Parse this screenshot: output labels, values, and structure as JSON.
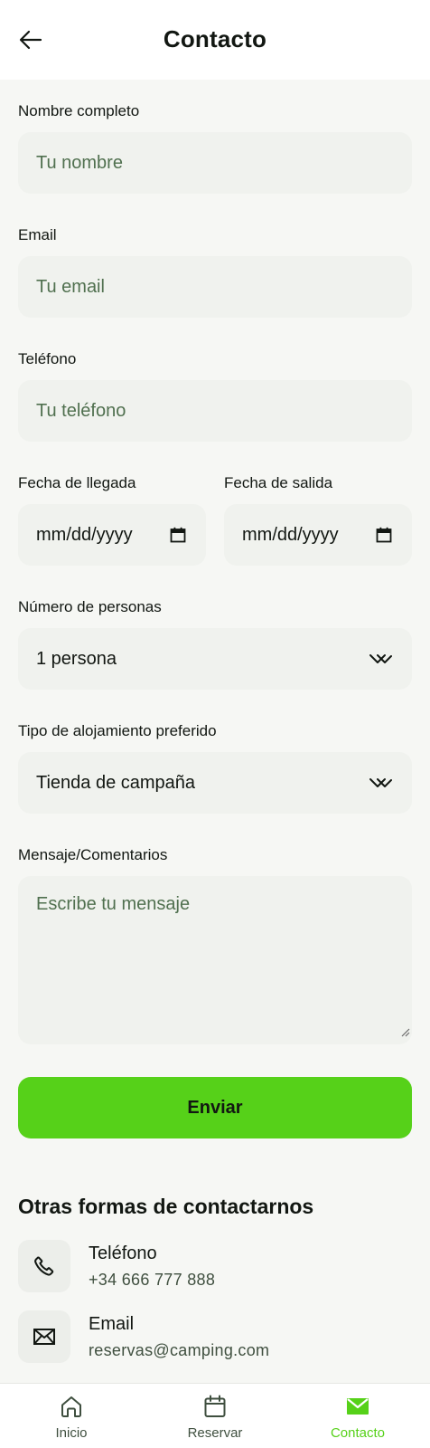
{
  "header": {
    "title": "Contacto"
  },
  "form": {
    "name": {
      "label": "Nombre completo",
      "placeholder": "Tu nombre"
    },
    "email": {
      "label": "Email",
      "placeholder": "Tu email"
    },
    "phone": {
      "label": "Teléfono",
      "placeholder": "Tu teléfono"
    },
    "arrival": {
      "label": "Fecha de llegada",
      "placeholder": "mm/dd/yyyy"
    },
    "departure": {
      "label": "Fecha de salida",
      "placeholder": "mm/dd/yyyy"
    },
    "guests": {
      "label": "Número de personas",
      "value": "1 persona"
    },
    "accommodation": {
      "label": "Tipo de alojamiento preferido",
      "value": "Tienda de campaña"
    },
    "message": {
      "label": "Mensaje/Comentarios",
      "placeholder": "Escribe tu mensaje"
    },
    "submit_label": "Enviar"
  },
  "other_contact": {
    "title": "Otras formas de contactarnos",
    "items": [
      {
        "title": "Teléfono",
        "value": "+34 666 777 888",
        "icon": "phone-icon"
      },
      {
        "title": "Email",
        "value": "reservas@camping.com",
        "icon": "mail-icon"
      }
    ]
  },
  "nav": {
    "items": [
      {
        "label": "Inicio",
        "icon": "home-icon"
      },
      {
        "label": "Reservar",
        "icon": "calendar-icon"
      },
      {
        "label": "Contacto",
        "icon": "mail-icon",
        "active": true
      }
    ]
  },
  "colors": {
    "accent": "#56d119",
    "input_bg": "#f0f2ee",
    "page_bg": "#f6f7f4",
    "text": "#121712",
    "placeholder": "#50704f"
  }
}
